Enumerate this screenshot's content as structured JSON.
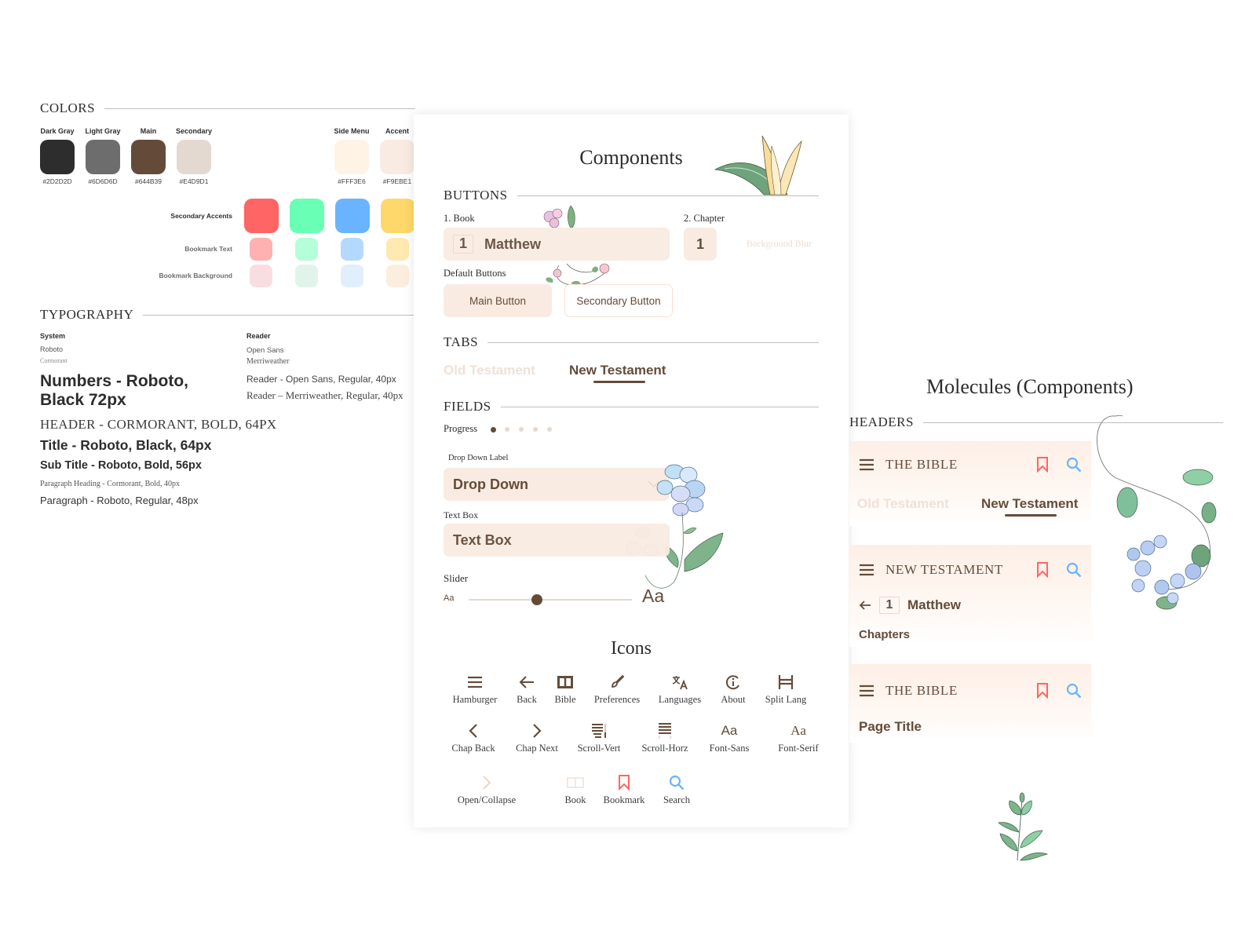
{
  "colors": {
    "heading": "COLORS",
    "palette": [
      {
        "name": "Dark Gray",
        "hex": "#2D2D2D"
      },
      {
        "name": "Light Gray",
        "hex": "#6D6D6D"
      },
      {
        "name": "Main",
        "hex": "#644B39"
      },
      {
        "name": "Secondary",
        "hex": "#E4D9D1"
      },
      {
        "name": "Side Menu",
        "hex": "#FFF3E6"
      },
      {
        "name": "Accent",
        "hex": "#F9EBE1"
      }
    ],
    "rows": {
      "secondary_accents": "Secondary Accents",
      "bookmark_text": "Bookmark Text",
      "bookmark_background": "Bookmark Background"
    },
    "secondary_accents": [
      "#FF6565",
      "#69FFB4",
      "#6AB4FF",
      "#FED86A"
    ],
    "bookmark_text": [
      "#FFB0B0",
      "#B4FFD9",
      "#B4D9FF",
      "#FFE9B0"
    ],
    "bookmark_background": [
      "#FADDE1",
      "#E1F4EC",
      "#E1EEFC",
      "#FCEEDF"
    ]
  },
  "typography": {
    "heading": "TYPOGRAPHY",
    "system_label": "System",
    "system_fonts": [
      "Roboto",
      "Cormorant"
    ],
    "reader_label": "Reader",
    "reader_fonts": [
      "Open Sans",
      "Merriweather"
    ],
    "samples": {
      "numbers": "Numbers - Roboto, Black 72px",
      "reader_open_sans": "Reader - Open Sans, Regular, 40px",
      "reader_merriweather": "Reader – Merriweather, Regular, 40px",
      "header": "HEADER - CORMORANT, BOLD, 64PX",
      "title": "Title - Roboto, Black, 64px",
      "subtitle": "Sub Title - Roboto, Bold, 56px",
      "paragraph_heading": "Paragraph Heading - Cormorant, Bold, 40px",
      "paragraph": "Paragraph - Roboto, Regular, 48px"
    }
  },
  "components": {
    "title": "Components",
    "buttons": {
      "heading": "BUTTONS",
      "book_label": "1. Book",
      "book_number": "1",
      "book_name": "Matthew",
      "chapter_label": "2. Chapter",
      "chapter_number": "1",
      "background_blur": "Background Blur",
      "default_label": "Default Buttons",
      "main_button": "Main Button",
      "secondary_button": "Secondary Button"
    },
    "tabs": {
      "heading": "TABS",
      "items": [
        "Old Testament",
        "New Testament"
      ],
      "active": "New Testament"
    },
    "fields": {
      "heading": "FIELDS",
      "progress_label": "Progress",
      "progress_total": 5,
      "progress_current": 1,
      "dropdown_label": "Drop Down Label",
      "dropdown_value": "Drop Down",
      "textbox_label": "Text Box",
      "textbox_value": "Text Box",
      "slider_label": "Slider",
      "slider_min_label": "Aa",
      "slider_max_label": "Aa",
      "slider_value": 0.42
    },
    "icons": {
      "heading": "Icons",
      "row1": [
        "Hamburger",
        "Back",
        "Bible",
        "Preferences",
        "Languages",
        "About",
        "Split Lang"
      ],
      "row2": [
        "Chap Back",
        "Chap Next",
        "Scroll-Vert",
        "Scroll-Horz",
        "Font-Sans",
        "Font-Serif"
      ],
      "row3": [
        "Open/Collapse",
        "Book",
        "Bookmark",
        "Search"
      ],
      "font_glyph": "Aa"
    }
  },
  "molecules": {
    "title": "Molecules (Components)",
    "headers_heading": "HEADERS",
    "header1": {
      "title": "THE BIBLE",
      "tabs": [
        "Old Testament",
        "New Testament"
      ],
      "active": "New Testament"
    },
    "header2": {
      "title": "NEW TESTAMENT",
      "book_number": "1",
      "book_name": "Matthew",
      "subtitle": "Chapters"
    },
    "header3": {
      "title": "THE BIBLE",
      "page_title": "Page Title"
    }
  }
}
